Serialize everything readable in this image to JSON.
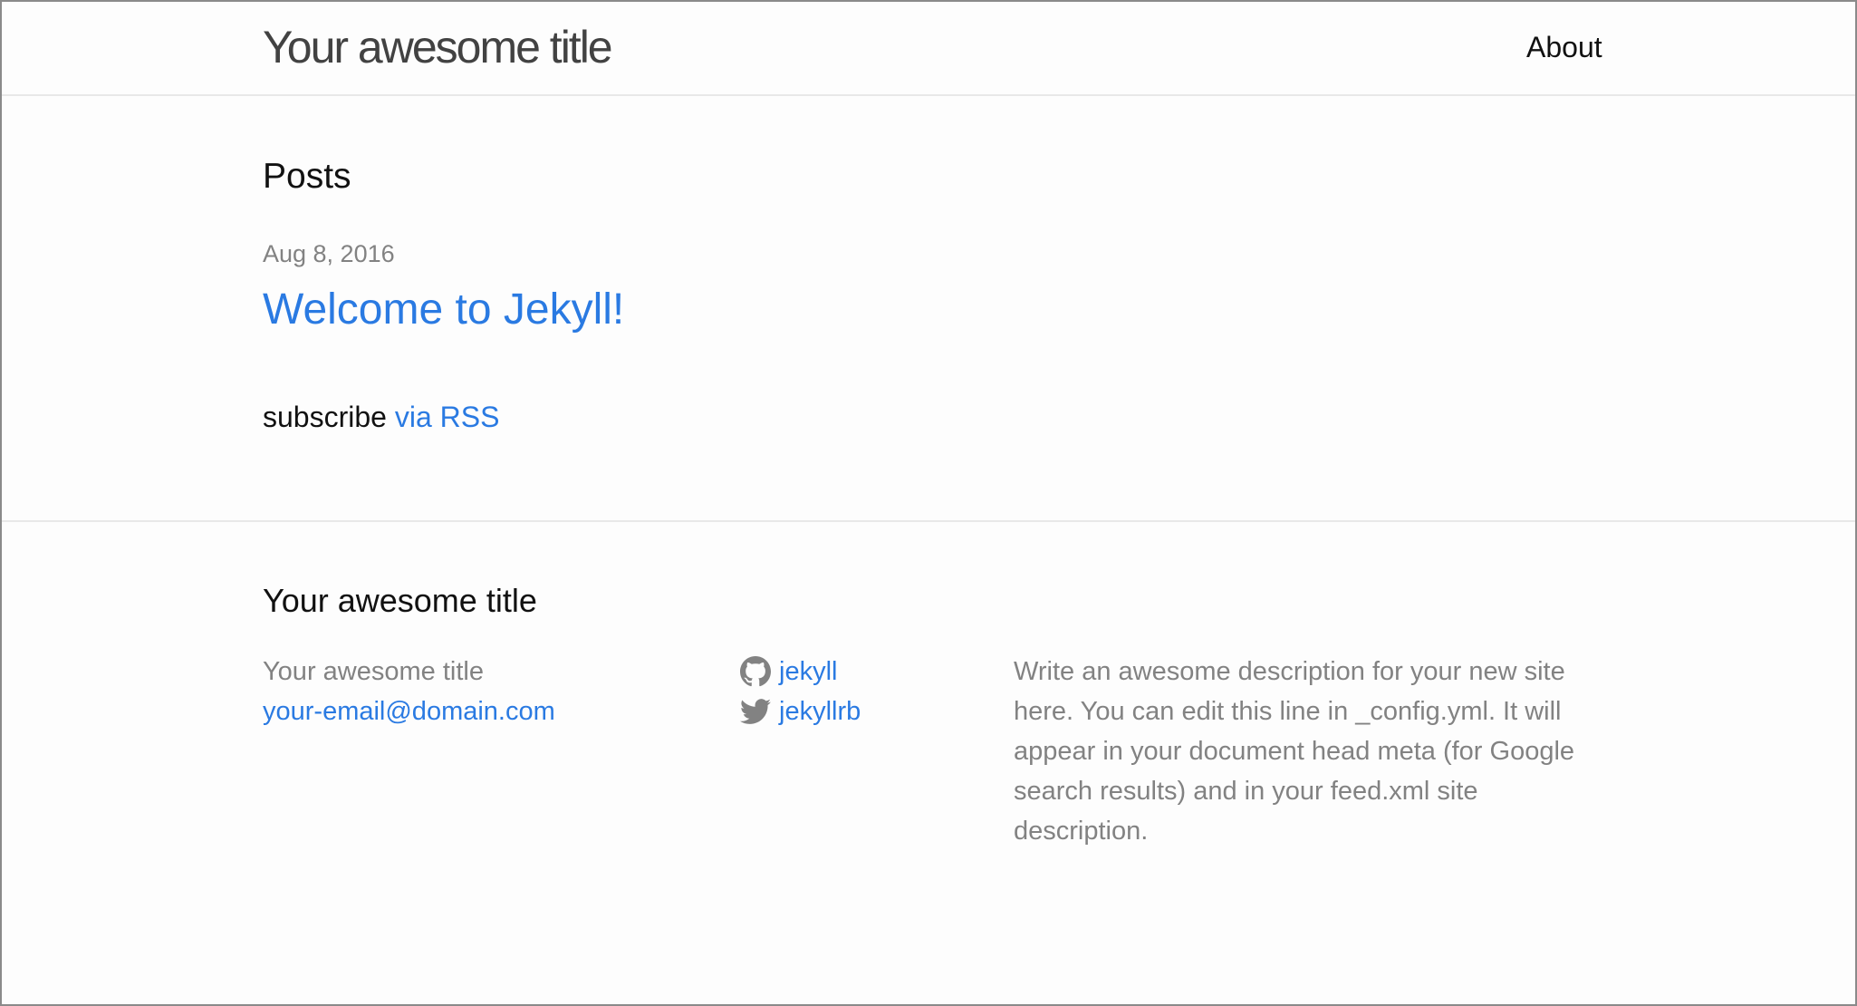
{
  "header": {
    "site_title": "Your awesome title",
    "nav": [
      {
        "label": "About"
      }
    ]
  },
  "main": {
    "heading": "Posts",
    "posts": [
      {
        "date": "Aug 8, 2016",
        "title": "Welcome to Jekyll!"
      }
    ],
    "subscribe": {
      "text": "subscribe",
      "link_label": "via RSS"
    }
  },
  "footer": {
    "heading": "Your awesome title",
    "site_name": "Your awesome title",
    "email": "your-email@domain.com",
    "social": [
      {
        "icon": "github-icon",
        "username": "jekyll"
      },
      {
        "icon": "twitter-icon",
        "username": "jekyllrb"
      }
    ],
    "description": "Write an awesome description for your new site here. You can edit this line in _config.yml. It will appear in your document head meta (for Google search results) and in your feed.xml site description."
  },
  "colors": {
    "text": "#111111",
    "muted": "#828282",
    "link": "#2a7ae2",
    "border": "#e8e8e8",
    "background": "#fdfdfd"
  }
}
